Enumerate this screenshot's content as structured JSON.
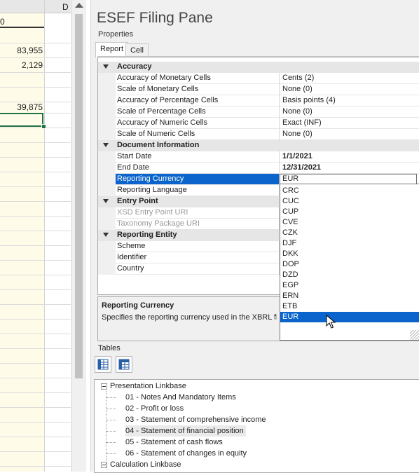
{
  "spreadsheet": {
    "column_header": "D",
    "first_cell_partial": "0",
    "values": [
      "83,955",
      "2,129",
      "39,875"
    ]
  },
  "pane": {
    "title": "ESEF Filing Pane",
    "properties_label": "Properties",
    "tabs": [
      "Report",
      "Cell"
    ],
    "categories": {
      "accuracy": "Accuracy",
      "document_information": "Document Information",
      "entry_point": "Entry Point",
      "reporting_entity": "Reporting Entity"
    },
    "rows": {
      "acc_monetary": {
        "label": "Accuracy of Monetary Cells",
        "value": "Cents (2)"
      },
      "scale_monetary": {
        "label": "Scale of Monetary Cells",
        "value": "None (0)"
      },
      "acc_percentage": {
        "label": "Accuracy of Percentage Cells",
        "value": "Basis points (4)"
      },
      "scale_percentage": {
        "label": "Scale of Percentage Cells",
        "value": "None (0)"
      },
      "acc_numeric": {
        "label": "Accuracy of Numeric Cells",
        "value": "Exact (INF)"
      },
      "scale_numeric": {
        "label": "Scale of Numeric Cells",
        "value": "None (0)"
      },
      "start_date": {
        "label": "Start Date",
        "value": "1/1/2021"
      },
      "end_date": {
        "label": "End Date",
        "value": "12/31/2021"
      },
      "reporting_currency": {
        "label": "Reporting Currency",
        "value": "EUR"
      },
      "reporting_language": {
        "label": "Reporting Language",
        "value": ""
      },
      "xsd_uri": {
        "label": "XSD Entry Point URI",
        "value": ""
      },
      "taxonomy_uri": {
        "label": "Taxonomy Package URI",
        "value": ""
      },
      "scheme": {
        "label": "Scheme",
        "value": ""
      },
      "identifier": {
        "label": "Identifier",
        "value": ""
      },
      "country": {
        "label": "Country",
        "value": ""
      }
    },
    "help": {
      "title": "Reporting Currency",
      "description": "Specifies the reporting currency used in the XBRL fi"
    },
    "currency_options": [
      "CRC",
      "CUC",
      "CUP",
      "CVE",
      "CZK",
      "DJF",
      "DKK",
      "DOP",
      "DZD",
      "EGP",
      "ERN",
      "ETB",
      "EUR"
    ],
    "selected_currency": "EUR",
    "tables_label": "Tables",
    "tree": {
      "presentation": "Presentation Linkbase",
      "items": [
        "01 - Notes And Mandatory Items",
        "02 - Profit or loss",
        "03 - Statement of comprehensive income",
        "04 - Statement of financial position",
        "05 - Statement of cash flows",
        "06 - Statement of changes in equity"
      ],
      "calculation": "Calculation Linkbase"
    }
  },
  "colors": {
    "selection_blue": "#0a64cc",
    "sheet_fill": "#fefce8",
    "active_cell_border": "#217346"
  }
}
